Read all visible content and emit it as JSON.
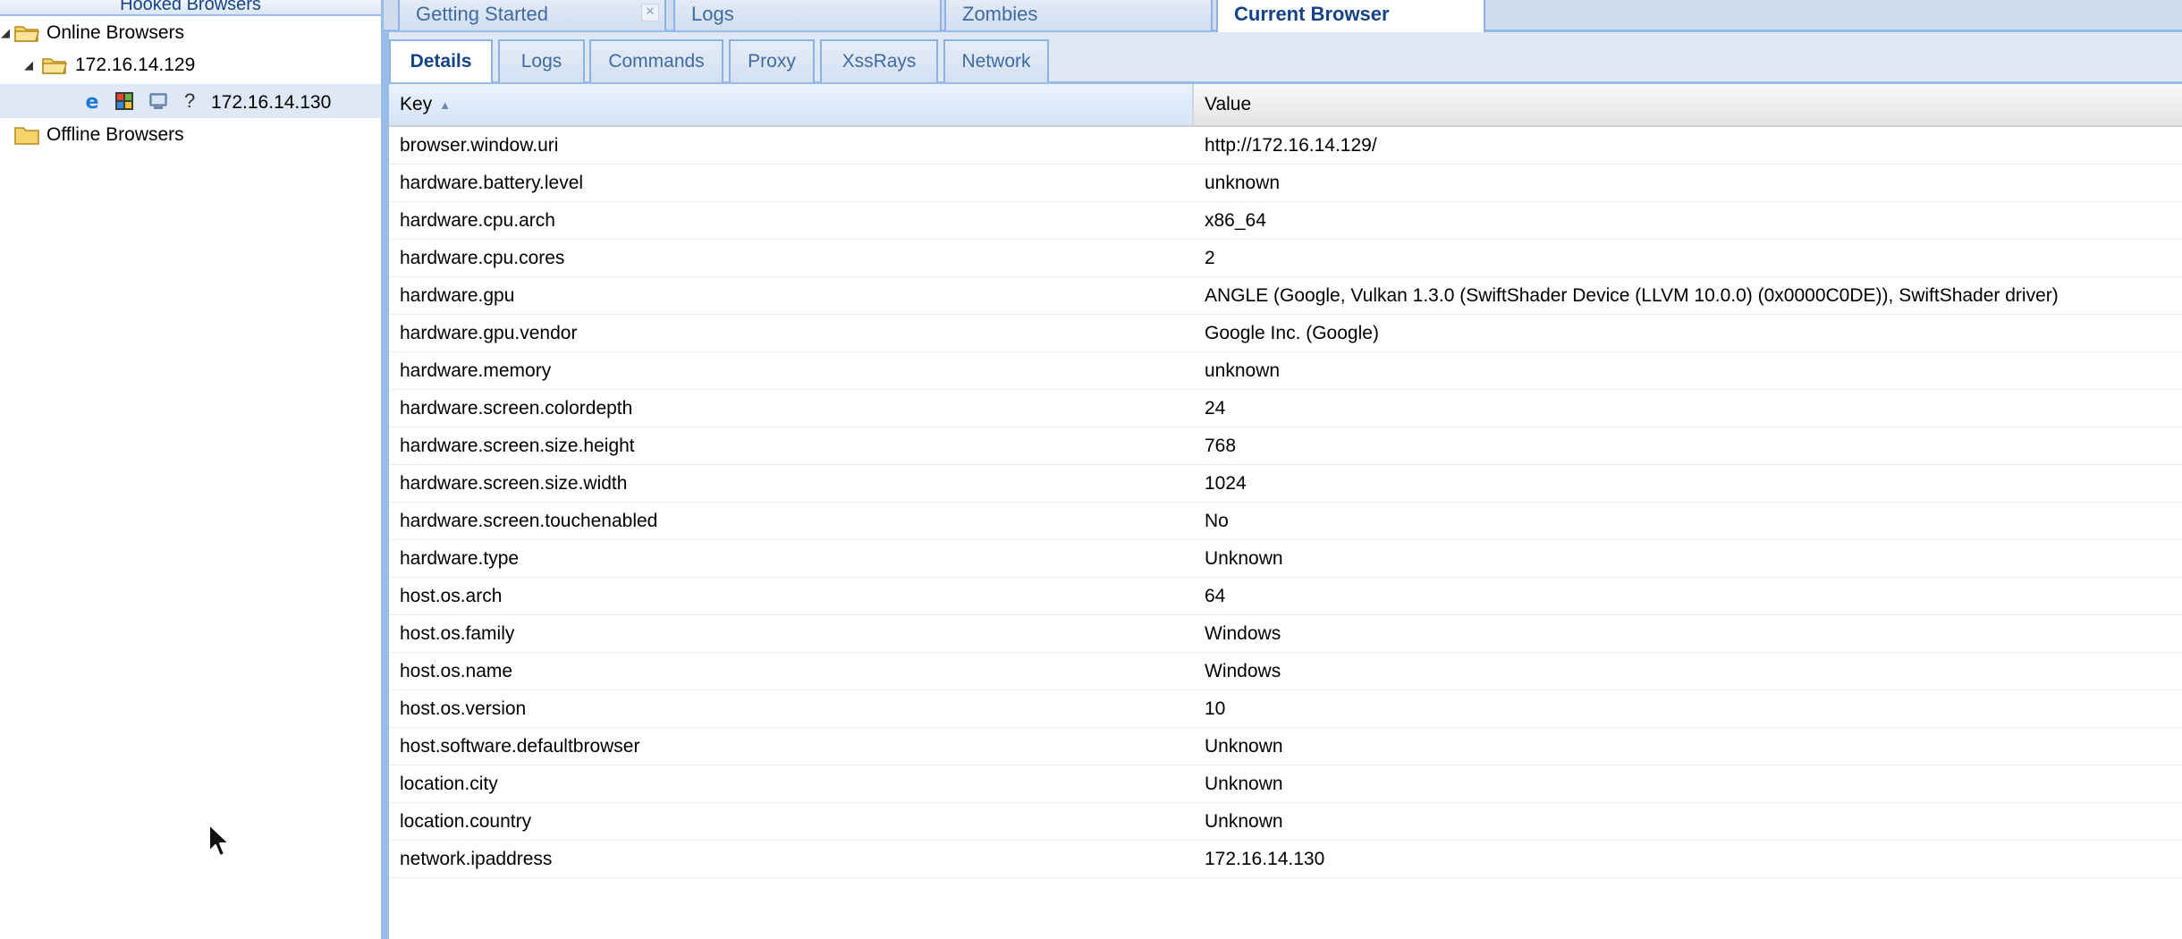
{
  "left_panel": {
    "header_title": "Hooked Browsers",
    "online_label": "Online Browsers",
    "host_label": "172.16.14.129",
    "browser_label": "172.16.14.130",
    "offline_label": "Offline Browsers",
    "unknown_glyph": "?"
  },
  "top_tabs": [
    {
      "label": "Getting Started",
      "closable": true,
      "close_glyph": "✕"
    },
    {
      "label": "Logs"
    },
    {
      "label": "Zombies"
    },
    {
      "label": "Current Browser",
      "active": true
    }
  ],
  "sub_tabs": [
    {
      "label": "Details",
      "active": true
    },
    {
      "label": "Logs"
    },
    {
      "label": "Commands"
    },
    {
      "label": "Proxy"
    },
    {
      "label": "XssRays"
    },
    {
      "label": "Network"
    }
  ],
  "grid": {
    "key_header": "Key",
    "value_header": "Value",
    "sort_glyph": "▲",
    "rows": [
      {
        "key": "browser.window.uri",
        "value": "http://172.16.14.129/"
      },
      {
        "key": "hardware.battery.level",
        "value": "unknown"
      },
      {
        "key": "hardware.cpu.arch",
        "value": "x86_64"
      },
      {
        "key": "hardware.cpu.cores",
        "value": "2"
      },
      {
        "key": "hardware.gpu",
        "value": "ANGLE (Google, Vulkan 1.3.0 (SwiftShader Device (LLVM 10.0.0) (0x0000C0DE)), SwiftShader driver)"
      },
      {
        "key": "hardware.gpu.vendor",
        "value": "Google Inc. (Google)"
      },
      {
        "key": "hardware.memory",
        "value": "unknown"
      },
      {
        "key": "hardware.screen.colordepth",
        "value": "24"
      },
      {
        "key": "hardware.screen.size.height",
        "value": "768"
      },
      {
        "key": "hardware.screen.size.width",
        "value": "1024"
      },
      {
        "key": "hardware.screen.touchenabled",
        "value": "No"
      },
      {
        "key": "hardware.type",
        "value": "Unknown"
      },
      {
        "key": "host.os.arch",
        "value": "64"
      },
      {
        "key": "host.os.family",
        "value": "Windows"
      },
      {
        "key": "host.os.name",
        "value": "Windows"
      },
      {
        "key": "host.os.version",
        "value": "10"
      },
      {
        "key": "host.software.defaultbrowser",
        "value": "Unknown"
      },
      {
        "key": "location.city",
        "value": "Unknown"
      },
      {
        "key": "location.country",
        "value": "Unknown"
      },
      {
        "key": "network.ipaddress",
        "value": "172.16.14.130"
      }
    ]
  },
  "colors": {
    "panel_border": "#99bbe8",
    "tab_text": "#416aa3",
    "active_tab_text": "#15428b",
    "selected_row": "#dfe8f6",
    "folder": "#f2c94c"
  }
}
